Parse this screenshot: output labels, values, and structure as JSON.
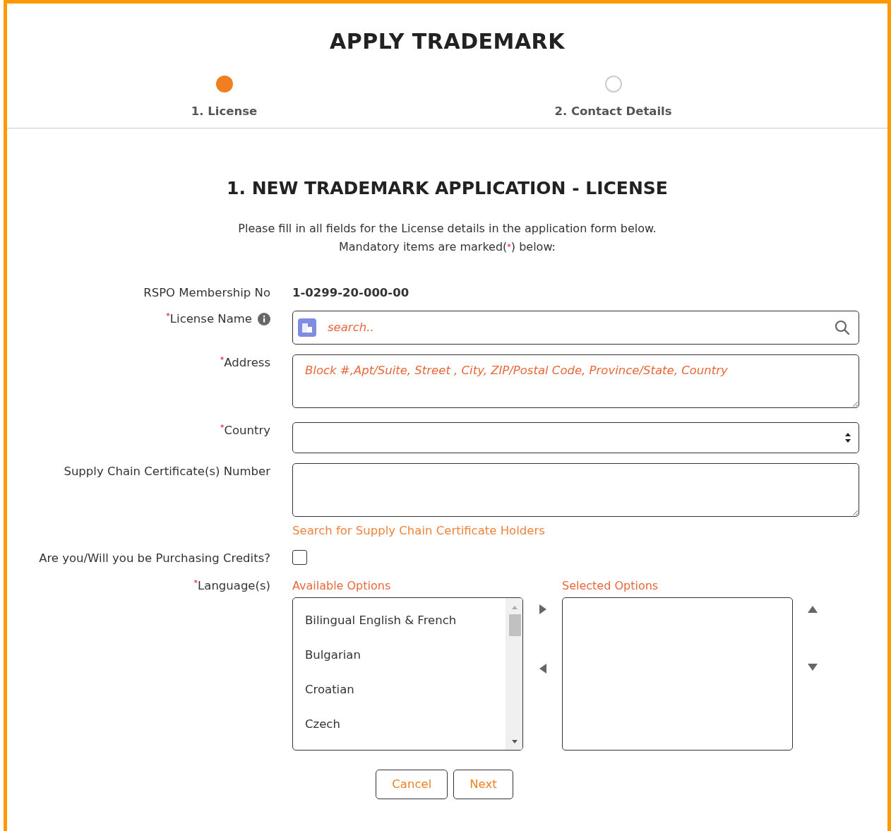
{
  "title": "APPLY TRADEMARK",
  "steps": [
    {
      "label": "1. License",
      "selected": true
    },
    {
      "label": "2. Contact Details",
      "selected": false
    }
  ],
  "section_title": "1. NEW TRADEMARK APPLICATION - LICENSE",
  "instructions": {
    "line_1": "Please fill in all fields for the License details in the application form below.",
    "line_2_before": "Mandatory items are marked(",
    "line_2_mark": "*",
    "line_2_after": ") below:"
  },
  "fields": [
    {
      "kind": "readonly",
      "label": "RSPO Membership No",
      "value": "1-0299-20-000-00"
    },
    {
      "kind": "lookup",
      "label": "License Name",
      "required_mark": "*",
      "info": true,
      "placeholder": "search.."
    },
    {
      "kind": "textarea",
      "label": "Address",
      "required_mark": "*",
      "placeholder": "Block #,Apt/Suite, Street , City, ZIP/Postal Code, Province/State, Country"
    },
    {
      "kind": "select",
      "label": "Country",
      "required_mark": "*"
    },
    {
      "kind": "textarea",
      "label": "Supply Chain Certificate(s) Number",
      "link": "Search for Supply Chain Certificate Holders"
    },
    {
      "kind": "checkbox",
      "label": "Are you/Will you be Purchasing Credits?",
      "checked": false
    },
    {
      "kind": "dual_list",
      "label": "Language(s)",
      "required_mark": "*",
      "available_label": "Available Options",
      "selected_label": "Selected Options",
      "available": [
        "Bilingual English & French",
        "Bulgarian",
        "Croatian",
        "Czech"
      ]
    }
  ],
  "buttons": [
    "Cancel",
    "Next"
  ]
}
